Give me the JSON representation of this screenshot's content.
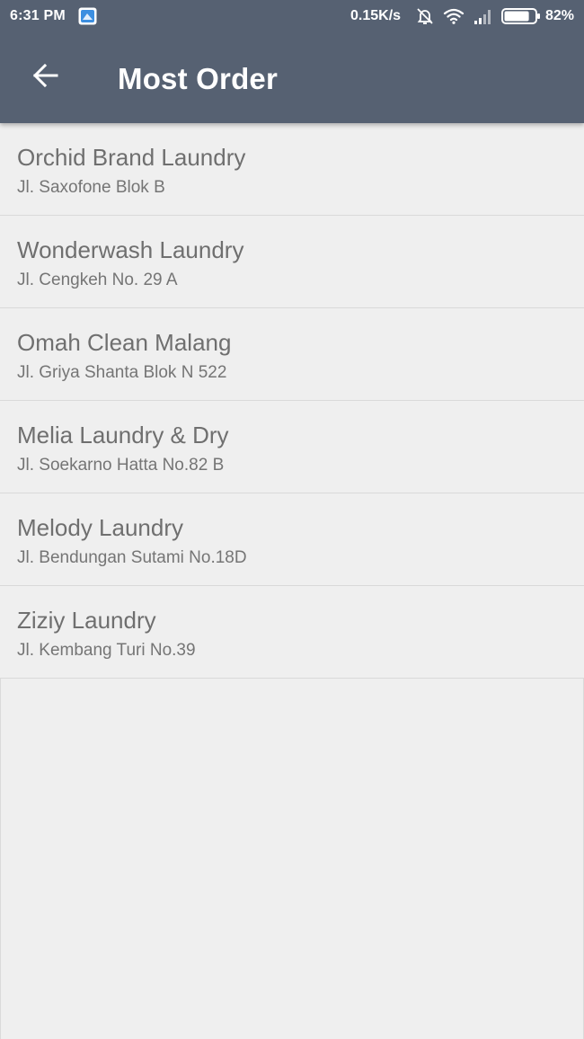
{
  "status_bar": {
    "time": "6:31 PM",
    "network_speed": "0.15K/s",
    "battery_percent": "82%",
    "battery_level": 0.82,
    "icons": [
      "notification-app-icon",
      "mute-icon",
      "wifi-icon",
      "signal-icon",
      "battery-icon"
    ]
  },
  "toolbar": {
    "title": "Most Order",
    "back_icon": "arrow-left-icon"
  },
  "colors": {
    "header": "#566172",
    "background": "#efefef",
    "text_primary": "#6f6f6f",
    "text_secondary": "#757575",
    "divider": "#d9d9d9"
  },
  "laundries": [
    {
      "name": "Orchid Brand Laundry",
      "address": "Jl. Saxofone Blok B"
    },
    {
      "name": "Wonderwash Laundry",
      "address": "Jl. Cengkeh No. 29 A"
    },
    {
      "name": "Omah Clean Malang",
      "address": "Jl. Griya Shanta Blok N 522"
    },
    {
      "name": "Melia Laundry & Dry",
      "address": "Jl. Soekarno Hatta No.82 B"
    },
    {
      "name": "Melody Laundry",
      "address": "Jl. Bendungan Sutami No.18D"
    },
    {
      "name": "Ziziy Laundry",
      "address": "Jl. Kembang Turi No.39"
    }
  ]
}
